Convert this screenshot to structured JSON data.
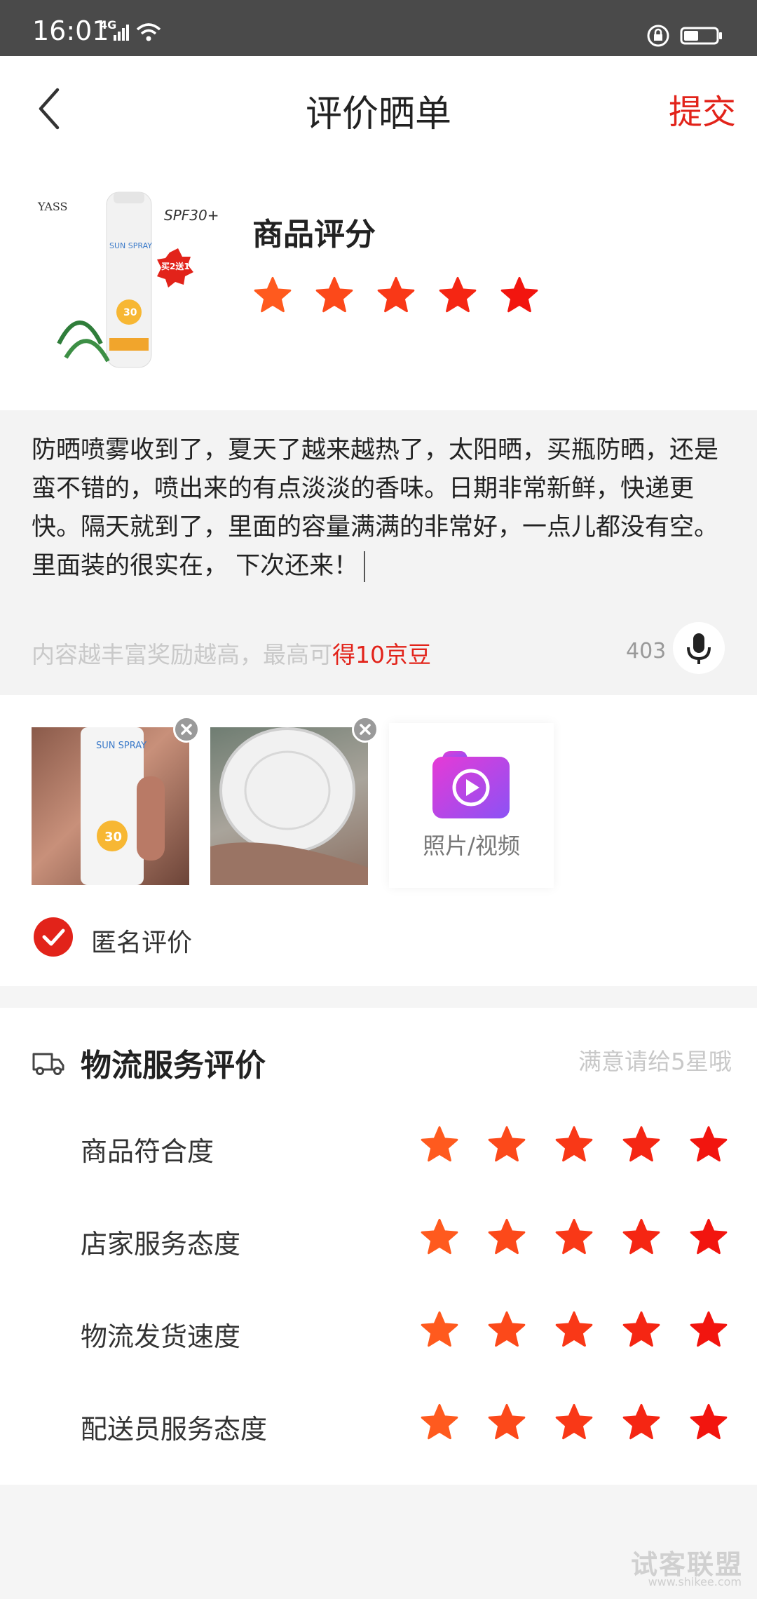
{
  "status_bar": {
    "time": "16:01",
    "network": "4G"
  },
  "header": {
    "title": "评价晒单",
    "submit_label": "提交"
  },
  "product": {
    "rating_title": "商品评分",
    "rating": 5
  },
  "review": {
    "text": "防晒喷雾收到了，夏天了越来越热了，太阳晒，买瓶防晒，还是蛮不错的，喷出来的有点淡淡的香味。日期非常新鲜，快递更快。隔天就到了，里面的容量满满的非常好，一点儿都没有空。里面装的很实在， 下次还来！",
    "hint_prefix": "内容越丰富奖励越高，最高可",
    "hint_highlight": "得10京豆",
    "char_count": "403"
  },
  "media": {
    "add_label": "照片/视频"
  },
  "anonymous": {
    "label": "匿名评价",
    "checked": true
  },
  "logistics": {
    "title": "物流服务评价",
    "hint": "满意请给5星哦",
    "rows": [
      {
        "label": "商品符合度",
        "rating": 5
      },
      {
        "label": "店家服务态度",
        "rating": 5
      },
      {
        "label": "物流发货速度",
        "rating": 5
      },
      {
        "label": "配送员服务态度",
        "rating": 5
      }
    ]
  },
  "watermark": {
    "text": "试客联盟",
    "url": "www.shikee.com"
  },
  "colors": {
    "accent": "#e2231a",
    "star_start": "#ff5a1e",
    "star_end": "#f2150f"
  }
}
